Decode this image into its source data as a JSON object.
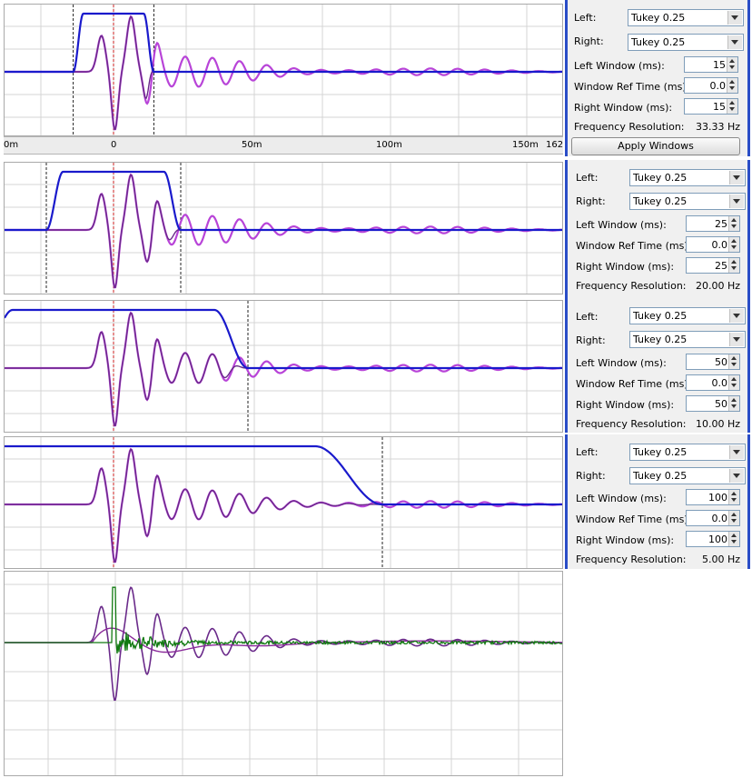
{
  "axis": {
    "ticks": [
      "0m",
      "0",
      "50m",
      "100m",
      "150m",
      "162"
    ]
  },
  "panels": [
    {
      "left_label": "Left:",
      "left_value": "Tukey 0.25",
      "right_label": "Right:",
      "right_value": "Tukey 0.25",
      "left_window_label": "Left Window (ms):",
      "left_window": "15",
      "ref_time_label": "Window Ref Time (ms):",
      "ref_time": "0.0",
      "right_window_label": "Right Window (ms):",
      "right_window": "15",
      "freq_label": "Frequency Resolution:",
      "freq_value": "33.33 Hz",
      "apply_label": "Apply Windows"
    },
    {
      "left_label": "Left:",
      "left_value": "Tukey 0.25",
      "right_label": "Right:",
      "right_value": "Tukey 0.25",
      "left_window_label": "Left Window (ms):",
      "left_window": "25",
      "ref_time_label": "Window Ref Time (ms):",
      "ref_time": "0.0",
      "right_window_label": "Right Window (ms):",
      "right_window": "25",
      "freq_label": "Frequency Resolution:",
      "freq_value": "20.00 Hz"
    },
    {
      "left_label": "Left:",
      "left_value": "Tukey 0.25",
      "right_label": "Right:",
      "right_value": "Tukey 0.25",
      "left_window_label": "Left Window (ms):",
      "left_window": "50",
      "ref_time_label": "Window Ref Time (ms):",
      "ref_time": "0.0",
      "right_window_label": "Right Window (ms):",
      "right_window": "50",
      "freq_label": "Frequency Resolution:",
      "freq_value": "10.00 Hz"
    },
    {
      "left_label": "Left:",
      "left_value": "Tukey 0.25",
      "right_label": "Right:",
      "right_value": "Tukey 0.25",
      "left_window_label": "Left Window (ms):",
      "left_window": "100",
      "ref_time_label": "Window Ref Time (ms):",
      "ref_time": "0.0",
      "right_window_label": "Right Window (ms):",
      "right_window": "100",
      "freq_label": "Frequency Resolution:",
      "freq_value": "5.00 Hz"
    }
  ],
  "colors": {
    "window": "#1a1acc",
    "impulse": "#b844d8",
    "windowed": "#6a2a8a",
    "step": "#117a11",
    "marker": "#cc2222",
    "grid": "#d4d4d4",
    "panel_border": "#2a4dc7"
  },
  "icons": {
    "dropdown": "chevron-down-icon",
    "spinner": "spinner-arrows-icon"
  }
}
